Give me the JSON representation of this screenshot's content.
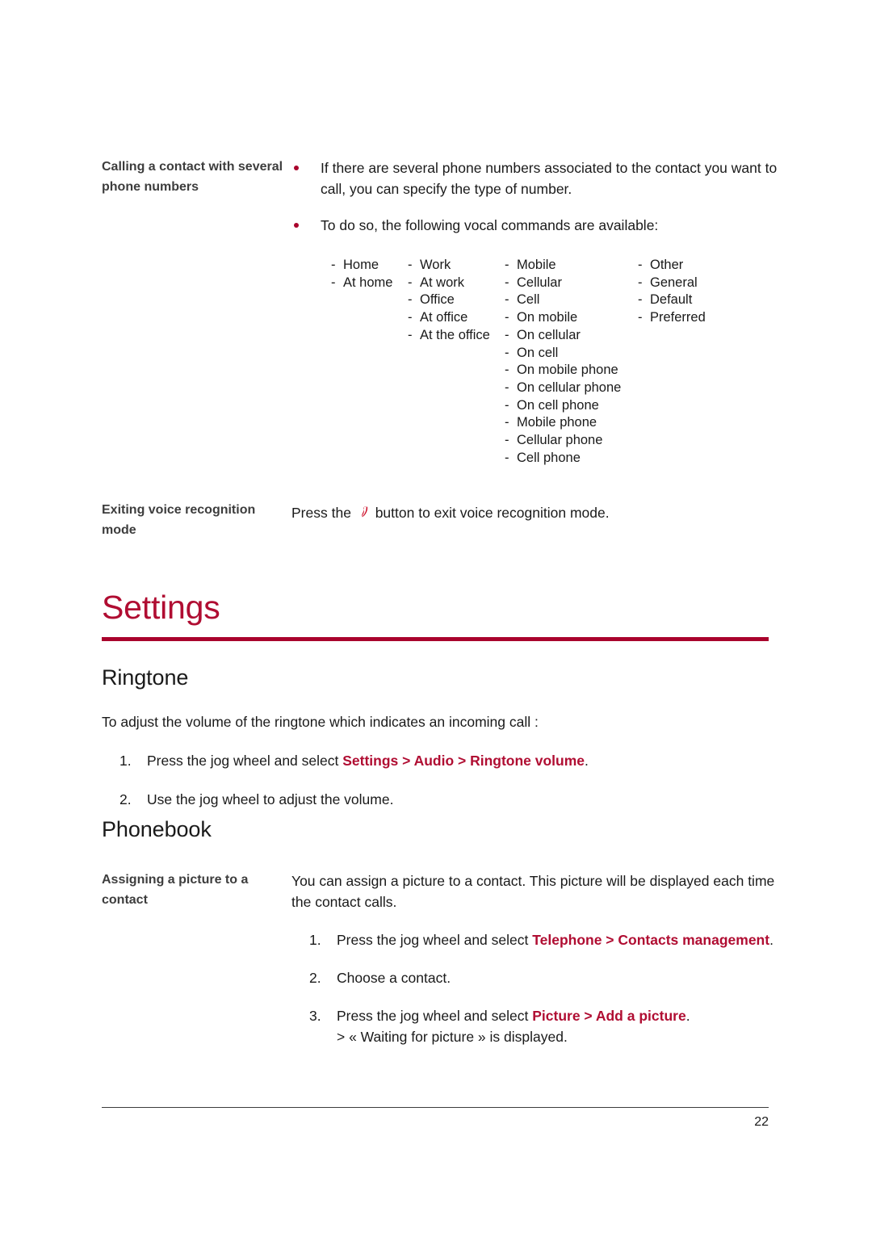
{
  "document": {
    "page_number": "22",
    "accent_color": "#b00d32",
    "rule_color": "#a9032c",
    "heading_color": "#3d3d3d",
    "body_color": "#1a1a1a"
  },
  "sections": {
    "calling": {
      "side_heading": "Calling a contact with several phone numbers",
      "bullets": [
        "If there are several phone numbers associated to the contact you want to call, you can specify the type of number.",
        "To do so, the following vocal commands are available:"
      ],
      "command_columns": [
        [
          "Home",
          "At home"
        ],
        [
          "Work",
          "At work",
          "Office",
          "At office",
          "At the office"
        ],
        [
          "Mobile",
          "Cellular",
          "Cell",
          "On mobile",
          "On cellular",
          "On cell",
          "On mobile phone",
          "On cellular phone",
          "On cell phone",
          "Mobile phone",
          "Cellular phone",
          "Cell phone"
        ],
        [
          "Other",
          "General",
          "Default",
          "Preferred"
        ]
      ],
      "dash": "-"
    },
    "exiting": {
      "side_heading": "Exiting voice recognition mode",
      "text_before_icon": "Press the",
      "icon_name": "hang-up-handset-icon",
      "text_after_icon": "button to exit voice recognition mode."
    }
  },
  "chapter": {
    "title": "Settings"
  },
  "ringtone": {
    "heading": "Ringtone",
    "intro": "To adjust the volume of the ringtone which indicates an incoming call :",
    "steps": [
      {
        "number": "1.",
        "lead": "Press the jog wheel and select ",
        "accent": "Settings > Audio > Ringtone volume",
        "tail": "."
      },
      {
        "number": "2.",
        "lead": "Use the jog wheel to adjust the volume.",
        "accent": "",
        "tail": ""
      }
    ]
  },
  "phonebook": {
    "heading": "Phonebook",
    "side_heading": "Assigning a picture to a contact",
    "intro": "You can assign a picture to a contact. This picture will be displayed each time the contact calls.",
    "steps": [
      {
        "number": "1.",
        "lead": "Press the jog wheel and select ",
        "accent": "Telephone > Contacts management",
        "tail": ".",
        "sub": ""
      },
      {
        "number": "2.",
        "lead": "Choose a contact.",
        "accent": "",
        "tail": "",
        "sub": ""
      },
      {
        "number": "3.",
        "lead": "Press the jog wheel and select ",
        "accent": "Picture > Add a picture",
        "tail": ".",
        "sub": "> « Waiting for picture » is displayed."
      }
    ]
  }
}
